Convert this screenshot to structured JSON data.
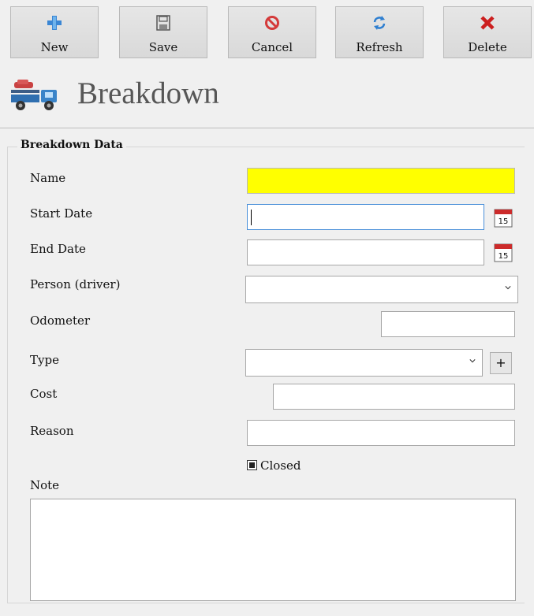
{
  "toolbar": {
    "new_label": "New",
    "save_label": "Save",
    "cancel_label": "Cancel",
    "refresh_label": "Refresh",
    "delete_label": "Delete"
  },
  "header": {
    "title": "Breakdown"
  },
  "form": {
    "group_title": "Breakdown Data",
    "name_label": "Name",
    "name_value": "",
    "start_date_label": "Start Date",
    "start_date_value": "",
    "end_date_label": "End Date",
    "end_date_value": "",
    "person_label": "Person (driver)",
    "person_value": "",
    "odometer_label": "Odometer",
    "odometer_value": "",
    "type_label": "Type",
    "type_value": "",
    "cost_label": "Cost",
    "cost_value": "",
    "reason_label": "Reason",
    "reason_value": "",
    "closed_label": "Closed",
    "note_label": "Note",
    "note_value": "",
    "calendar_day": "15",
    "add_type_label": "+"
  },
  "icons": {
    "new": "plus-icon",
    "save": "floppy-disk-icon",
    "cancel": "cancel-circle-icon",
    "refresh": "refresh-icon",
    "delete": "delete-x-icon",
    "header": "tow-truck-icon",
    "calendar": "calendar-icon"
  },
  "colors": {
    "required_field": "#ffff00",
    "focus_border": "#4a90d9",
    "new_icon": "#3a86d4",
    "cancel_icon": "#d43a3a",
    "delete_icon": "#cc1f1f",
    "refresh_icon": "#2f7fd0"
  }
}
